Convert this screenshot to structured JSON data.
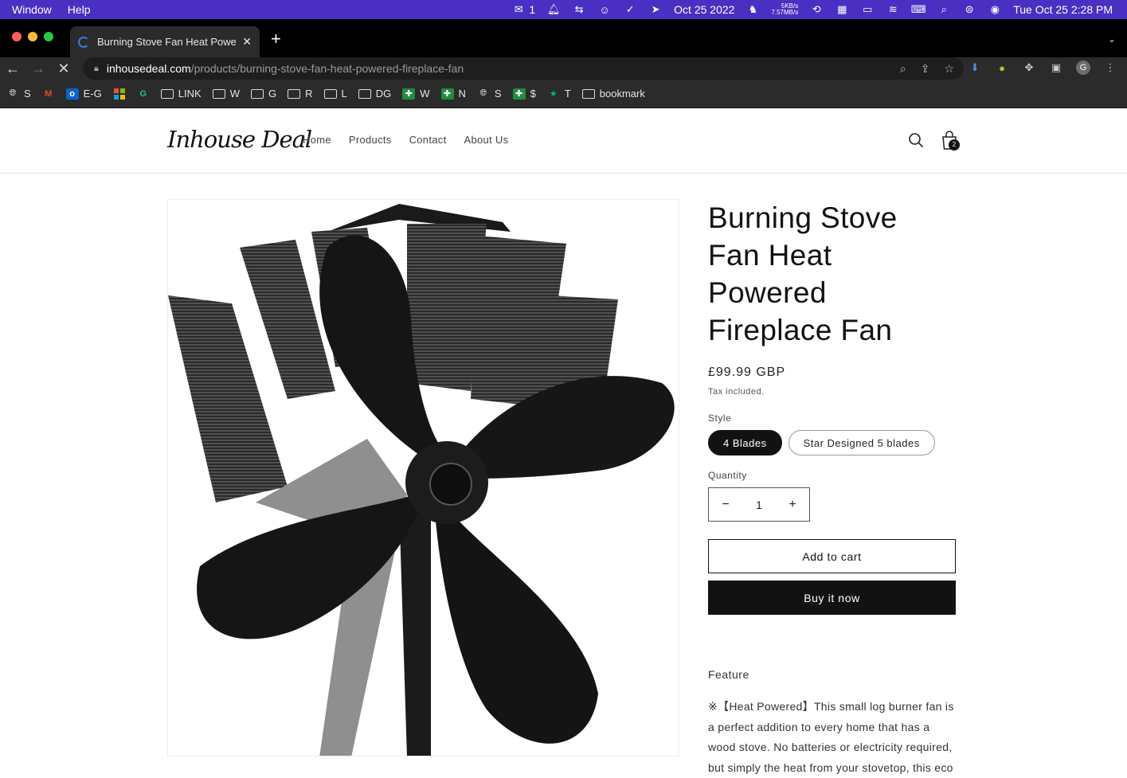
{
  "menubar": {
    "menus": [
      "Window",
      "Help"
    ],
    "wechat_count": "1",
    "date_short": "Oct 25 2022",
    "net_up": "5KB/s",
    "net_down": "7.57MB/s",
    "datetime": "Tue Oct 25  2:28 PM"
  },
  "browser": {
    "tab_title": "Burning Stove Fan Heat Powered Fireplace Fan",
    "url_host": "inhousedeal.com",
    "url_path": "/products/burning-stove-fan-heat-powered-fireplace-fan",
    "profile_initial": "G"
  },
  "bookmarks": [
    {
      "label": "S",
      "icon": "globe-icon"
    },
    {
      "label": "",
      "icon": "gmail-icon"
    },
    {
      "label": "E-G",
      "icon": "outlook-icon"
    },
    {
      "label": "",
      "icon": "microsoft-icon"
    },
    {
      "label": "",
      "icon": "grammarly-icon"
    },
    {
      "label": "LINK",
      "icon": "folder-icon"
    },
    {
      "label": "W",
      "icon": "folder-icon"
    },
    {
      "label": "G",
      "icon": "folder-icon"
    },
    {
      "label": "R",
      "icon": "folder-icon"
    },
    {
      "label": "L",
      "icon": "folder-icon"
    },
    {
      "label": "DG",
      "icon": "folder-icon"
    },
    {
      "label": "W",
      "icon": "green-plus-icon"
    },
    {
      "label": "N",
      "icon": "green-plus-icon"
    },
    {
      "label": "S",
      "icon": "globe-icon"
    },
    {
      "label": "$",
      "icon": "green-plus-icon"
    },
    {
      "label": "T",
      "icon": "star-icon"
    },
    {
      "label": "bookmark",
      "icon": "folder-icon"
    }
  ],
  "site": {
    "logo": "Inhouse Deal",
    "nav": [
      "Home",
      "Products",
      "Contact",
      "About Us"
    ],
    "cart_count": "2"
  },
  "product": {
    "title": "Burning Stove Fan Heat Powered Fireplace Fan",
    "price": "£99.99 GBP",
    "tax_note": "Tax included.",
    "style_label": "Style",
    "styles": [
      "4 Blades",
      "Star Designed 5 blades"
    ],
    "selected_style": "4 Blades",
    "quantity_label": "Quantity",
    "quantity": "1",
    "add_to_cart": "Add to cart",
    "buy_now": "Buy it now",
    "feature_heading": "Feature",
    "description": "※【Heat Powered】This small log burner fan is a perfect addition to every home that has a wood stove. No batteries or electricity required, but simply the heat from your stovetop, this eco"
  },
  "colors": {
    "menubar": "#4a2fc3",
    "button_dark": "#121212"
  }
}
